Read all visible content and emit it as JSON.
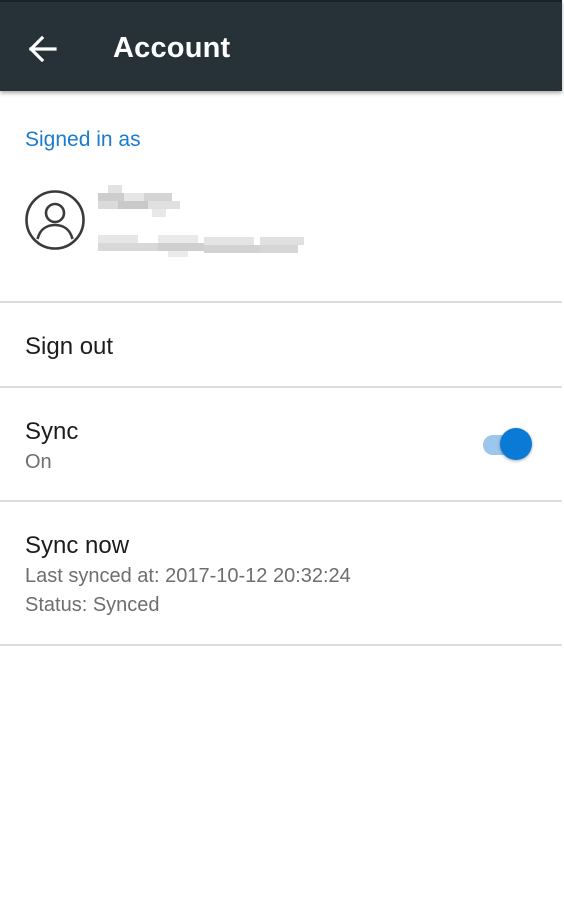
{
  "appbar": {
    "title": "Account",
    "back_icon": "arrow-left-icon",
    "background": "#263238"
  },
  "account": {
    "signed_in_label": "Signed in as",
    "avatar_icon": "person-circle-icon",
    "accent_color": "#1a7bd1"
  },
  "rows": {
    "sign_out": {
      "title": "Sign out"
    },
    "sync": {
      "title": "Sync",
      "state_label": "On",
      "enabled": true,
      "toggle_color": "#0b79d6"
    },
    "sync_now": {
      "title": "Sync now",
      "last_synced": "Last synced at: 2017-10-12 20:32:24",
      "status": "Status: Synced"
    }
  }
}
